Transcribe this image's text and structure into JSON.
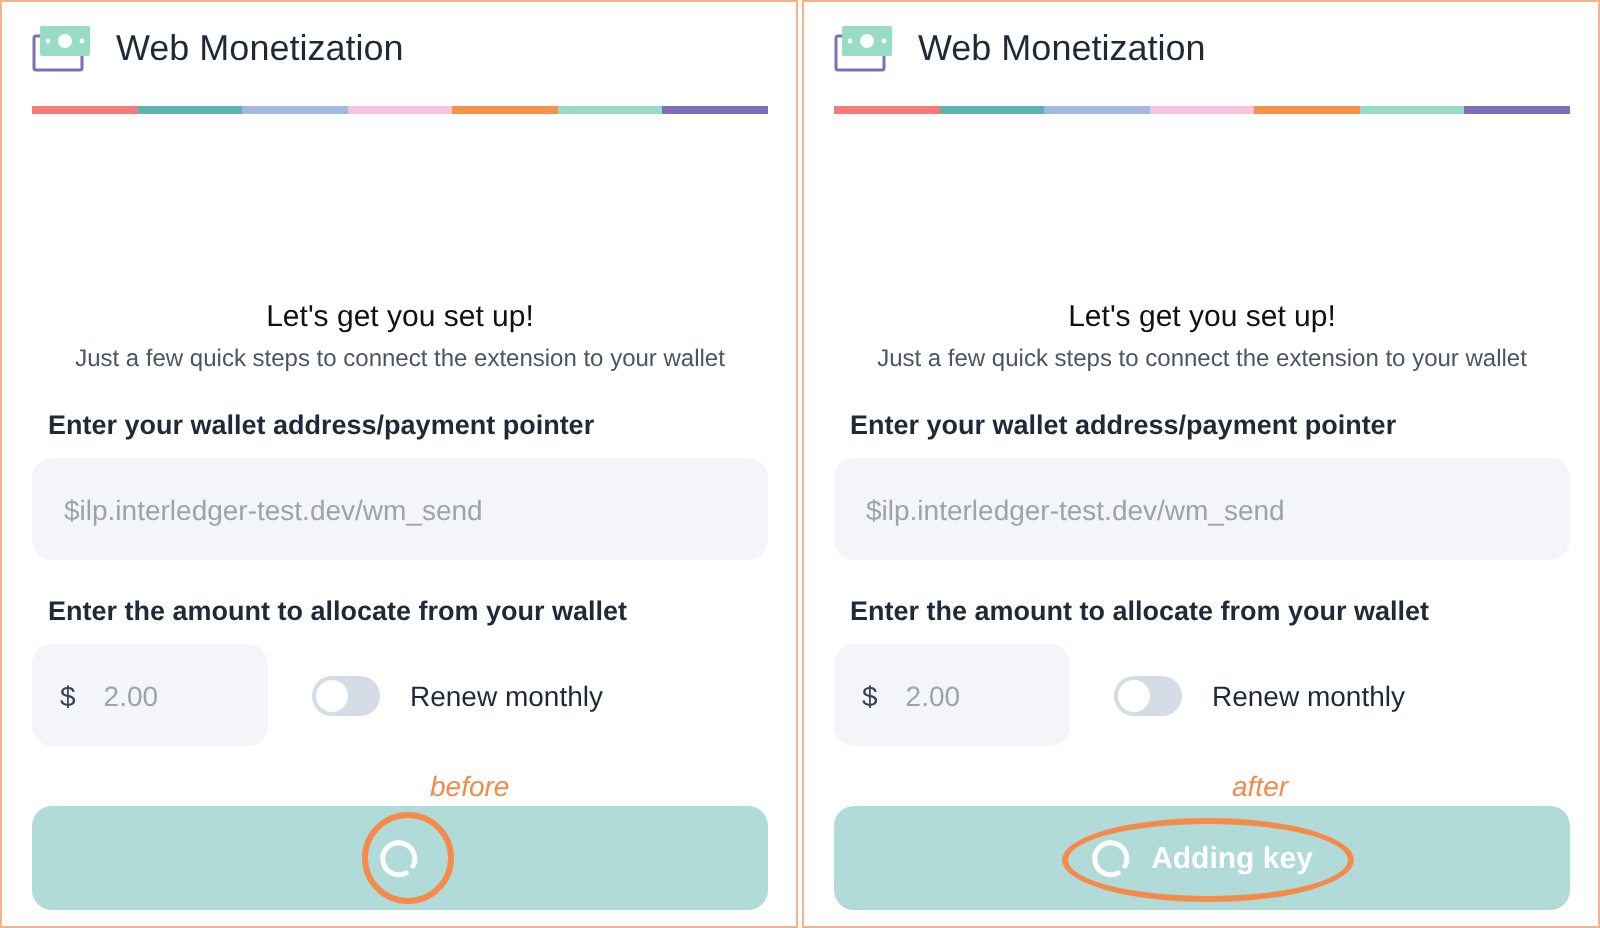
{
  "panels": [
    {
      "title": "Web Monetization",
      "heading": "Let's get you set up!",
      "subheading": "Just a few quick steps to connect the extension to your wallet",
      "wallet_label": "Enter your wallet address/payment pointer",
      "wallet_field": {
        "placeholder": "$ilp.interledger-test.dev/wm_send"
      },
      "amount_label": "Enter the amount to allocate from your wallet",
      "amount_field": {
        "currency": "$",
        "placeholder": "2.00"
      },
      "renew": {
        "label": "Renew monthly",
        "on": false
      },
      "submit_button": {
        "kind": "spinner"
      },
      "annotation": {
        "text": "before",
        "kind": "circle"
      }
    },
    {
      "title": "Web Monetization",
      "heading": "Let's get you set up!",
      "subheading": "Just a few quick steps to connect the extension to your wallet",
      "wallet_label": "Enter your wallet address/payment pointer",
      "wallet_field": {
        "placeholder": "$ilp.interledger-test.dev/wm_send"
      },
      "amount_label": "Enter the amount to allocate from your wallet",
      "amount_field": {
        "currency": "$",
        "placeholder": "2.00"
      },
      "renew": {
        "label": "Renew monthly",
        "on": false
      },
      "submit_button": {
        "kind": "spinner-label",
        "label": "Adding key"
      },
      "annotation": {
        "text": "after",
        "kind": "ellipse"
      }
    }
  ]
}
